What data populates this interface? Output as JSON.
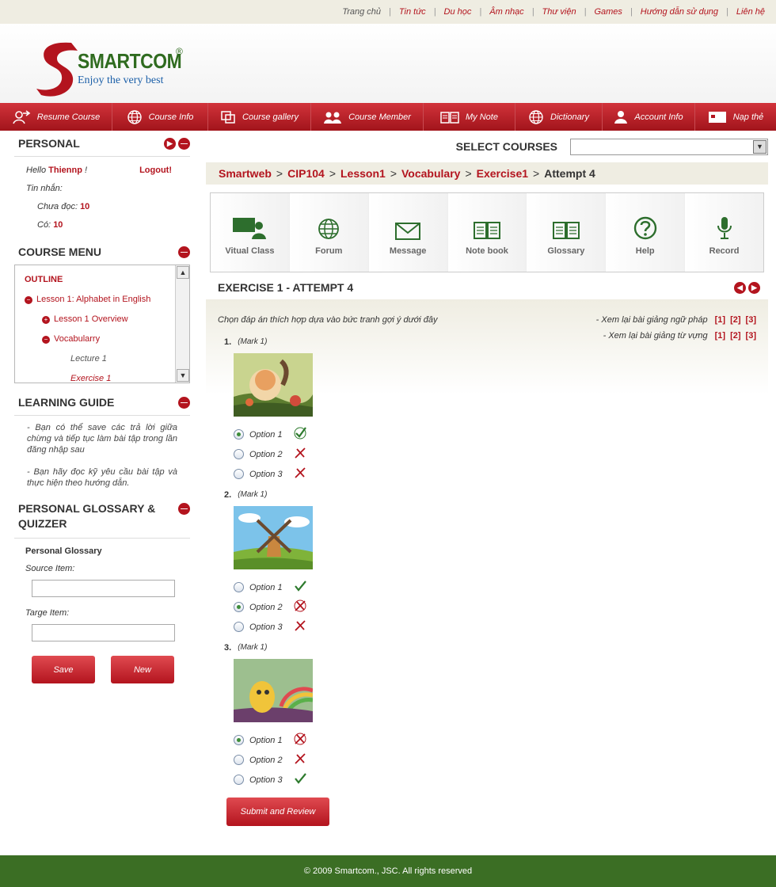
{
  "top_links": [
    "Trang chủ",
    "Tin tức",
    "Du học",
    "Âm nhạc",
    "Thư viện",
    "Games",
    "Hướng dẫn sử dụng",
    "Liên hệ"
  ],
  "logo": {
    "brand": "SMARTCOM",
    "reg": "®",
    "tagline": "Enjoy the very best"
  },
  "nav": [
    {
      "label": "Resume Course",
      "icon": "resume-icon"
    },
    {
      "label": "Course Info",
      "icon": "globe-icon"
    },
    {
      "label": "Course gallery",
      "icon": "gallery-icon"
    },
    {
      "label": "Course Member",
      "icon": "members-icon"
    },
    {
      "label": "My Note",
      "icon": "note-icon"
    },
    {
      "label": "Dictionary",
      "icon": "globe-icon"
    },
    {
      "label": "Account Info",
      "icon": "account-icon"
    },
    {
      "label": "Nạp thẻ",
      "icon": "card-icon"
    }
  ],
  "personal": {
    "title": "PERSONAL",
    "hello": "Hello",
    "user": "Thiennp",
    "excl": "!",
    "logout": "Logout!",
    "messages_label": "Tin nhắn:",
    "unread_label": "Chưa đọc:",
    "unread": "10",
    "total_label": "Có:",
    "total": "10"
  },
  "course_menu": {
    "title": "COURSE MENU",
    "outline": "OUTLINE",
    "lesson": "Lesson 1: Alphabet in English",
    "overview": "Lesson 1 Overview",
    "vocabulary": "Vocabularry",
    "lecture": "Lecture 1",
    "exercise": "Exercise 1"
  },
  "learning_guide": {
    "title": "LEARNING GUIDE",
    "p1": "- Bạn có thể save các trả lời giữa chừng và tiếp tục làm bài tập trong lần đăng nhập sau",
    "p2": "- Bạn hãy đọc kỹ yêu cầu bài tập và thực hiện theo hướng dẫn."
  },
  "glossary": {
    "title": "PERSONAL GLOSSARY & QUIZZER",
    "subtitle": "Personal Glossary",
    "source_label": "Source Item:",
    "target_label": "Targe Item:",
    "source_value": "",
    "target_value": "",
    "save": "Save",
    "new": "New"
  },
  "select_courses": {
    "label": "SELECT COURSES",
    "value": ""
  },
  "breadcrumb": {
    "a": "Smartweb",
    "b": "CIP104",
    "c": "Lesson1",
    "d": "Vocabulary",
    "e": "Exercise1",
    "current": "Attempt 4",
    "sep": ">"
  },
  "tools": [
    {
      "label": "Vitual Class",
      "icon": "virtual-class-icon"
    },
    {
      "label": "Forum",
      "icon": "forum-globe-icon"
    },
    {
      "label": "Message",
      "icon": "message-envelope-icon"
    },
    {
      "label": "Note book",
      "icon": "notebook-icon"
    },
    {
      "label": "Glossary",
      "icon": "glossary-book-icon"
    },
    {
      "label": "Help",
      "icon": "help-icon"
    },
    {
      "label": "Record",
      "icon": "microphone-icon"
    }
  ],
  "exercise": {
    "title": "EXERCISE 1 - ATTEMPT 4",
    "instruction": "Chọn đáp án thích hợp dựa vào bức tranh gợi ý dưới đây",
    "grammar_review": "- Xem lại bài giảng ngữ pháp",
    "vocab_review": "- Xem lại bài giảng từ vựng",
    "refs": [
      "[1]",
      "[2]",
      "[3]"
    ],
    "submit": "Submit and Review",
    "questions": [
      {
        "num": "1.",
        "mark": "(Mark 1)",
        "options": [
          {
            "label": "Option 1",
            "selected": true,
            "result": "correct-circled"
          },
          {
            "label": "Option 2",
            "selected": false,
            "result": "wrong"
          },
          {
            "label": "Option 3",
            "selected": false,
            "result": "wrong"
          }
        ]
      },
      {
        "num": "2.",
        "mark": "(Mark 1)",
        "options": [
          {
            "label": "Option 1",
            "selected": false,
            "result": "correct"
          },
          {
            "label": "Option 2",
            "selected": true,
            "result": "wrong-circled"
          },
          {
            "label": "Option 3",
            "selected": false,
            "result": "wrong"
          }
        ]
      },
      {
        "num": "3.",
        "mark": "(Mark 1)",
        "options": [
          {
            "label": "Option 1",
            "selected": true,
            "result": "wrong-circled"
          },
          {
            "label": "Option 2",
            "selected": false,
            "result": "wrong"
          },
          {
            "label": "Option 3",
            "selected": false,
            "result": "correct"
          }
        ]
      }
    ]
  },
  "footer": "© 2009 Smartcom., JSC. All rights reserved",
  "colors": {
    "accent": "#b3141e",
    "footer": "#3b6e24",
    "tool_icon": "#2d6e2d"
  }
}
